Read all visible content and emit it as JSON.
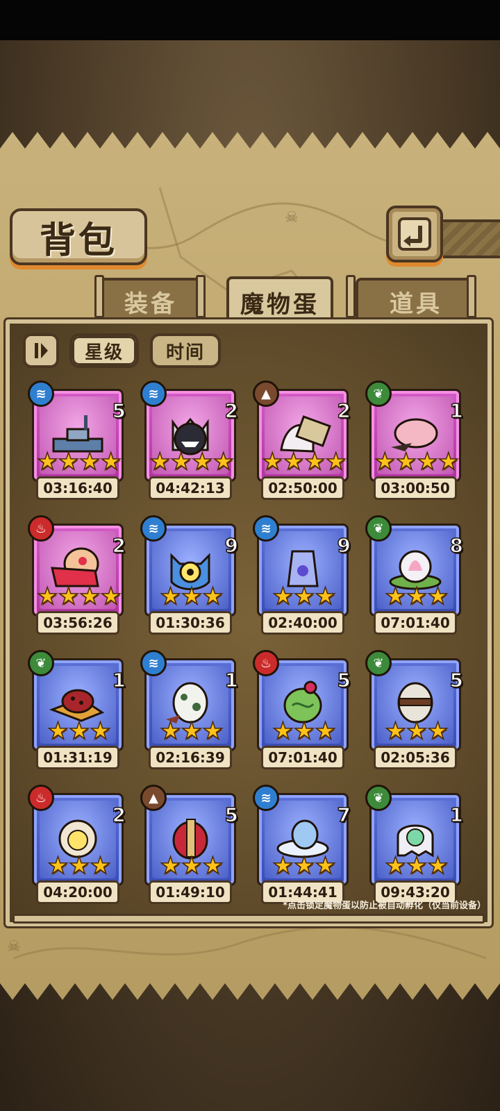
{
  "title": "背包",
  "tabs": [
    {
      "label": "装备",
      "active": false
    },
    {
      "label": "魔物蛋",
      "active": true
    },
    {
      "label": "道具",
      "active": false
    }
  ],
  "sort": {
    "toggle_icon": "sort-order-icon",
    "buttons": [
      {
        "label": "星级",
        "active": true
      },
      {
        "label": "时间",
        "active": false
      }
    ]
  },
  "back_icon": "return-arrow-icon",
  "eggs": [
    {
      "element": "water",
      "count": "5",
      "stars": 4,
      "time": "03:16:40",
      "rarity": "pink",
      "monster": "battleship"
    },
    {
      "element": "water",
      "count": "2",
      "stars": 4,
      "time": "04:42:13",
      "rarity": "pink",
      "monster": "black-spiky"
    },
    {
      "element": "earth",
      "count": "2",
      "stars": 4,
      "time": "02:50:00",
      "rarity": "pink",
      "monster": "shovel"
    },
    {
      "element": "leaf",
      "count": "1",
      "stars": 4,
      "time": "03:00:50",
      "rarity": "pink",
      "monster": "pink-pig"
    },
    {
      "element": "fire",
      "count": "2",
      "stars": 4,
      "time": "03:56:26",
      "rarity": "pink",
      "monster": "kimono"
    },
    {
      "element": "water",
      "count": "9",
      "stars": 3,
      "time": "01:30:36",
      "rarity": "blue",
      "monster": "blue-cat-eye"
    },
    {
      "element": "water",
      "count": "9",
      "stars": 3,
      "time": "02:40:00",
      "rarity": "blue",
      "monster": "crystal-jar"
    },
    {
      "element": "leaf",
      "count": "8",
      "stars": 3,
      "time": "07:01:40",
      "rarity": "blue",
      "monster": "lotus"
    },
    {
      "element": "leaf",
      "count": "1",
      "stars": 3,
      "time": "01:31:19",
      "rarity": "blue",
      "monster": "mushroom-hat"
    },
    {
      "element": "water",
      "count": "1",
      "stars": 3,
      "time": "02:16:39",
      "rarity": "blue",
      "monster": "spotted-egg"
    },
    {
      "element": "fire",
      "count": "5",
      "stars": 3,
      "time": "07:01:40",
      "rarity": "blue",
      "monster": "cactus"
    },
    {
      "element": "leaf",
      "count": "5",
      "stars": 3,
      "time": "02:05:36",
      "rarity": "blue",
      "monster": "studded-egg"
    },
    {
      "element": "fire",
      "count": "2",
      "stars": 3,
      "time": "04:20:00",
      "rarity": "blue",
      "monster": "sun-egg"
    },
    {
      "element": "earth",
      "count": "5",
      "stars": 3,
      "time": "01:49:10",
      "rarity": "blue",
      "monster": "helmet-egg"
    },
    {
      "element": "water",
      "count": "7",
      "stars": 3,
      "time": "01:44:41",
      "rarity": "blue",
      "monster": "cloud-egg"
    },
    {
      "element": "leaf",
      "count": "1",
      "stars": 3,
      "time": "09:43:20",
      "rarity": "blue",
      "monster": "rainbow-ghost"
    }
  ],
  "hint": "*点击锁定魔物蛋以防止被自动孵化（仅当前设备）"
}
